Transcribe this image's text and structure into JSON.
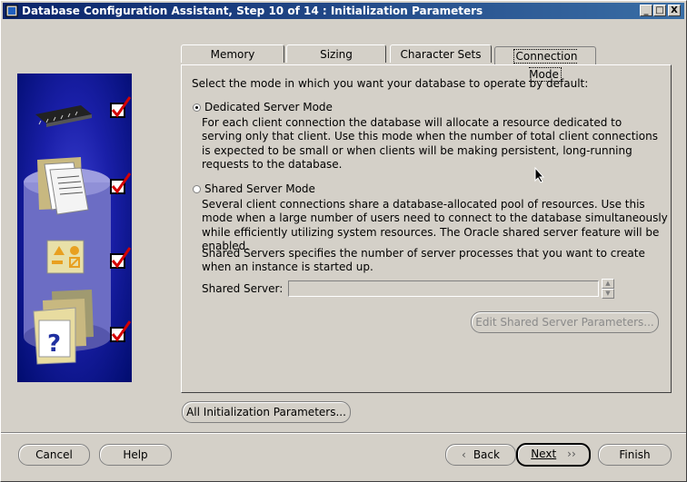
{
  "window": {
    "title": "Database Configuration Assistant, Step 10 of 14 : Initialization Parameters",
    "minimize": "_",
    "maximize": "□",
    "close": "X"
  },
  "tabs": [
    {
      "label": "Memory"
    },
    {
      "label": "Sizing"
    },
    {
      "label": "Character Sets"
    },
    {
      "label": "Connection Mode"
    }
  ],
  "connection_mode": {
    "intro": "Select the mode in which you want your database to operate by default:",
    "dedicated": {
      "label": "Dedicated Server Mode",
      "selected": true,
      "description": "For each client connection the database will allocate a resource dedicated to serving only that client.  Use this mode when the number of total client connections is expected to be small or when clients will be making persistent, long-running requests to the database."
    },
    "shared": {
      "label": "Shared Server Mode",
      "selected": false,
      "description": "Several client connections share a database-allocated pool of resources.  Use this mode when a large number of users need to connect to the database simultaneously while efficiently utilizing system resources.  The Oracle shared server feature will be enabled."
    },
    "shared_servers_note": "Shared Servers specifies the number of server processes that you want to create when an instance is started up.",
    "shared_server_label": "Shared Server:",
    "shared_server_value": "",
    "edit_button": "Edit Shared Server Parameters..."
  },
  "all_params_button": "All Initialization Parameters...",
  "footer": {
    "cancel": "Cancel",
    "help": "Help",
    "back": "Back",
    "next": "Next",
    "finish": "Finish"
  },
  "colors": {
    "title_bar": "#0a246a",
    "side_panel": "#1a1fa8",
    "checkmark": "#d40000"
  }
}
